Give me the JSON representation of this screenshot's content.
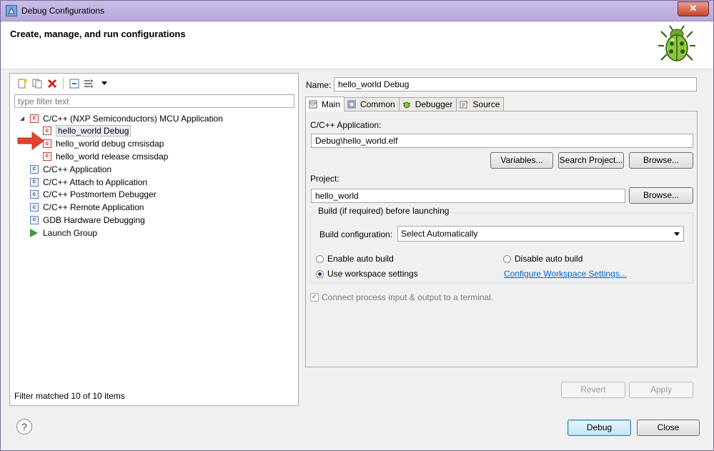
{
  "window": {
    "title": "Debug Configurations",
    "close_glyph": "✕"
  },
  "header": {
    "title": "Create, manage, and run configurations"
  },
  "left": {
    "filter_placeholder": "type filter text",
    "tree": [
      {
        "label": "C/C++ (NXP Semiconductors) MCU Application",
        "level": 0,
        "icon": "c-red-icon",
        "expanded": true
      },
      {
        "label": "hello_world Debug",
        "level": 1,
        "icon": "c-red-icon",
        "selected": true
      },
      {
        "label": "hello_world debug cmsisdap",
        "level": 1,
        "icon": "c-red-icon"
      },
      {
        "label": "hello_world release cmsisdap",
        "level": 1,
        "icon": "c-red-icon"
      },
      {
        "label": "C/C++ Application",
        "level": 0,
        "icon": "c-icon"
      },
      {
        "label": "C/C++ Attach to Application",
        "level": 0,
        "icon": "c-icon"
      },
      {
        "label": "C/C++ Postmortem Debugger",
        "level": 0,
        "icon": "c-icon"
      },
      {
        "label": "C/C++ Remote Application",
        "level": 0,
        "icon": "c-icon"
      },
      {
        "label": "GDB Hardware Debugging",
        "level": 0,
        "icon": "c-icon"
      },
      {
        "label": "Launch Group",
        "level": 0,
        "icon": "launch-icon"
      }
    ],
    "filter_status": "Filter matched 10 of 10 items"
  },
  "right": {
    "name_label": "Name:",
    "name_value": "hello_world Debug",
    "tabs": [
      {
        "label": "Main",
        "active": true
      },
      {
        "label": "Common"
      },
      {
        "label": "Debugger"
      },
      {
        "label": "Source"
      }
    ],
    "app_label": "C/C++ Application:",
    "app_value": "Debug\\hello_world.elf",
    "variables_button": "Variables...",
    "search_project_button": "Search Project...",
    "browse_button": "Browse...",
    "project_label": "Project:",
    "project_value": "hello_world",
    "project_browse_button": "Browse...",
    "build_group_title": "Build (if required) before launching",
    "build_config_label": "Build configuration:",
    "build_config_value": "Select Automatically",
    "enable_auto_build": "Enable auto build",
    "disable_auto_build": "Disable auto build",
    "use_workspace_settings": "Use workspace settings",
    "configure_workspace_link": "Configure Workspace Settings...",
    "connect_terminal": "Connect process input & output to a terminal.",
    "revert_button": "Revert",
    "apply_button": "Apply"
  },
  "footer": {
    "help_glyph": "?",
    "debug_button": "Debug",
    "close_button": "Close"
  }
}
